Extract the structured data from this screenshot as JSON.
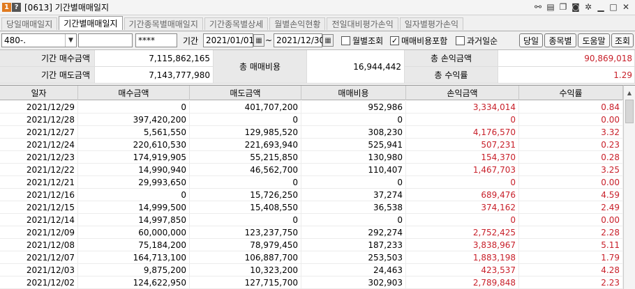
{
  "window": {
    "badge1": "1",
    "badge2": "?",
    "title": "[0613] 기간별매매일지"
  },
  "tabs": [
    {
      "label": "당일매매일지",
      "active": false
    },
    {
      "label": "기간별매매일지",
      "active": true
    },
    {
      "label": "기간종목별매매일지",
      "active": false
    },
    {
      "label": "기간종목별상세",
      "active": false
    },
    {
      "label": "월별손익현황",
      "active": false
    },
    {
      "label": "전일대비평가손익",
      "active": false
    },
    {
      "label": "일자별평가손익",
      "active": false
    }
  ],
  "toolbar": {
    "account_value": "480-.",
    "password_value": "****",
    "period_label": "기간",
    "date_from": "2021/01/01",
    "tilde": "~",
    "date_to": "2021/12/30",
    "monthly_label": "월별조회",
    "monthly_checked": false,
    "include_fee_label": "매매비용포함",
    "include_fee_checked": true,
    "past_order_label": "과거일순",
    "past_order_checked": false,
    "btn_today": "당일",
    "btn_by_stock": "종목별",
    "btn_help": "도움말",
    "btn_search": "조회"
  },
  "summary": {
    "buy_label": "기간 매수금액",
    "buy_value": "7,115,862,165",
    "sell_label": "기간 매도금액",
    "sell_value": "7,143,777,980",
    "fee_label": "총 매매비용",
    "fee_value": "16,944,442",
    "profit_label": "총 손익금액",
    "profit_value": "90,869,018",
    "rate_label": "총 수익률",
    "rate_value": "1.29"
  },
  "table": {
    "columns": [
      "일자",
      "매수금액",
      "매도금액",
      "매매비용",
      "손익금액",
      "수익률"
    ],
    "rows": [
      [
        "2021/12/29",
        "0",
        "401,707,200",
        "952,986",
        "3,334,014",
        "0.84"
      ],
      [
        "2021/12/28",
        "397,420,200",
        "0",
        "0",
        "0",
        "0.00"
      ],
      [
        "2021/12/27",
        "5,561,550",
        "129,985,520",
        "308,230",
        "4,176,570",
        "3.32"
      ],
      [
        "2021/12/24",
        "220,610,530",
        "221,693,940",
        "525,941",
        "507,231",
        "0.23"
      ],
      [
        "2021/12/23",
        "174,919,905",
        "55,215,850",
        "130,980",
        "154,370",
        "0.28"
      ],
      [
        "2021/12/22",
        "14,990,940",
        "46,562,700",
        "110,407",
        "1,467,703",
        "3.25"
      ],
      [
        "2021/12/21",
        "29,993,650",
        "0",
        "0",
        "0",
        "0.00"
      ],
      [
        "2021/12/16",
        "0",
        "15,726,250",
        "37,274",
        "689,476",
        "4.59"
      ],
      [
        "2021/12/15",
        "14,999,500",
        "15,408,550",
        "36,538",
        "374,162",
        "2.49"
      ],
      [
        "2021/12/14",
        "14,997,850",
        "0",
        "0",
        "0",
        "0.00"
      ],
      [
        "2021/12/09",
        "60,000,000",
        "123,237,750",
        "292,274",
        "2,752,425",
        "2.28"
      ],
      [
        "2021/12/08",
        "75,184,200",
        "78,979,450",
        "187,233",
        "3,838,967",
        "5.11"
      ],
      [
        "2021/12/07",
        "164,713,100",
        "106,887,700",
        "253,503",
        "1,883,198",
        "1.79"
      ],
      [
        "2021/12/03",
        "9,875,200",
        "10,323,200",
        "24,463",
        "423,537",
        "4.28"
      ],
      [
        "2021/12/02",
        "124,622,950",
        "127,715,700",
        "302,903",
        "2,789,848",
        "2.23"
      ]
    ]
  },
  "colors": {
    "profit": "#c8202a",
    "accent_badge": "#e07a1f"
  }
}
